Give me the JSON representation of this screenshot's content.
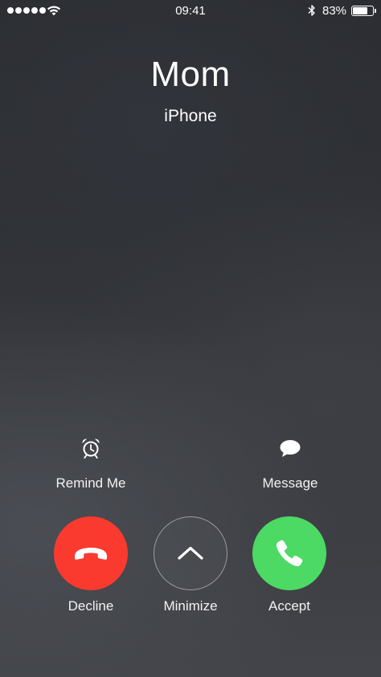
{
  "status_bar": {
    "signal_bars": 5,
    "time": "09:41",
    "battery_percent_label": "83%",
    "battery_level": 0.83,
    "icons": [
      "signal-dots",
      "wifi-icon",
      "bluetooth-icon",
      "battery-icon"
    ]
  },
  "caller": {
    "name": "Mom",
    "device": "iPhone"
  },
  "secondary_actions": {
    "remind_me": {
      "label": "Remind Me",
      "icon": "alarm-clock-icon"
    },
    "message": {
      "label": "Message",
      "icon": "speech-bubble-icon"
    }
  },
  "call_actions": {
    "decline": {
      "label": "Decline",
      "icon": "phone-hangup-icon",
      "color": "#fa3a2f"
    },
    "minimize": {
      "label": "Minimize",
      "icon": "chevron-up-icon"
    },
    "accept": {
      "label": "Accept",
      "icon": "phone-icon",
      "color": "#4cd964"
    }
  }
}
